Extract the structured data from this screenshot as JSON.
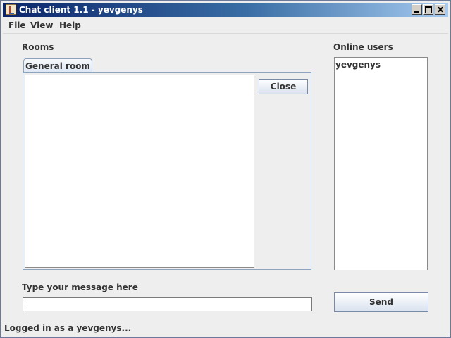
{
  "window": {
    "title": "Chat client 1.1 - yevgenys"
  },
  "menu": {
    "file": "File",
    "view": "View",
    "help": "Help"
  },
  "rooms": {
    "label": "Rooms",
    "tabs": [
      {
        "label": "General room"
      }
    ],
    "close_label": "Close"
  },
  "online_users": {
    "label": "Online users",
    "users": [
      "yevgenys"
    ]
  },
  "message": {
    "label": "Type your message here",
    "value": "",
    "send_label": "Send"
  },
  "status": "Logged in as a yevgenys..."
}
